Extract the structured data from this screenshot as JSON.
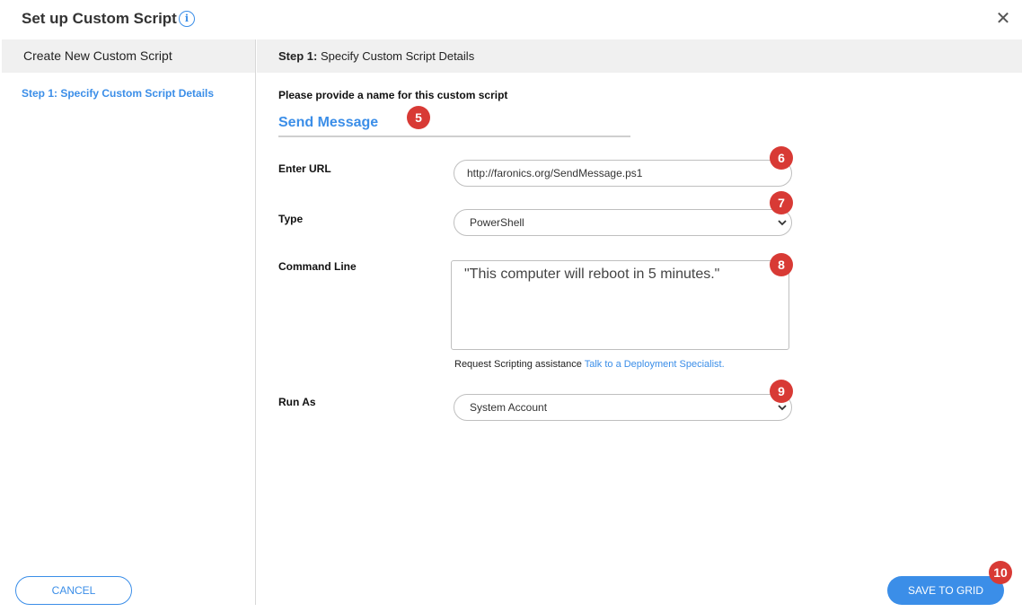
{
  "header": {
    "title": "Set up Custom Script",
    "info_icon_glyph": "i",
    "close_glyph": "✕"
  },
  "sidebar": {
    "header": "Create New Custom Script",
    "steps": [
      {
        "label": "Step 1: Specify Custom Script Details",
        "active": true
      }
    ]
  },
  "main": {
    "header_prefix": "Step 1:",
    "header_text": "Specify Custom Script Details",
    "prompt": "Please provide a name for this custom script",
    "script_name": "Send Message",
    "url_label": "Enter URL",
    "url_value": "http://faronics.org/SendMessage.ps1",
    "type_label": "Type",
    "type_value": "PowerShell",
    "command_label": "Command Line",
    "command_value": "\"This computer will reboot in 5 minutes.\"",
    "assist_text": "Request Scripting assistance",
    "assist_link": "Talk to a Deployment Specialist.",
    "runas_label": "Run As",
    "runas_value": "System Account"
  },
  "badges": [
    "5",
    "6",
    "7",
    "8",
    "9",
    "10"
  ],
  "footer": {
    "cancel_label": "CANCEL",
    "save_label": "SAVE TO GRID"
  },
  "colors": {
    "accent": "#3b8ee8",
    "badge": "#d83a35",
    "panel_bg": "#f0f0f0"
  }
}
